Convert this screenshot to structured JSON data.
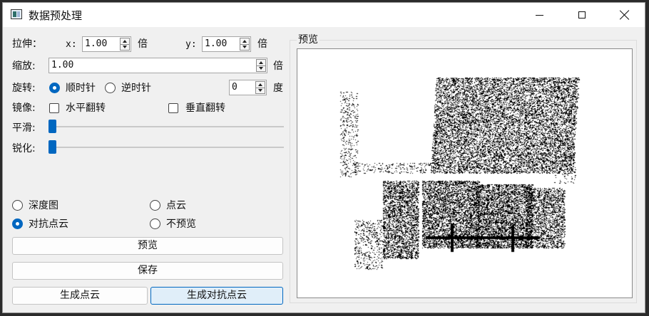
{
  "window": {
    "title": "数据预处理"
  },
  "stretch": {
    "label": "拉伸：",
    "x_label": "x:",
    "x_value": "1.00",
    "x_unit": "倍",
    "y_label": "y:",
    "y_value": "1.00",
    "y_unit": "倍"
  },
  "scale": {
    "label": "缩放:",
    "value": "1.00",
    "unit": "倍"
  },
  "rotate": {
    "label": "旋转:",
    "cw": "顺时针",
    "ccw": "逆时针",
    "degrees_value": "0",
    "unit": "度",
    "selected": "cw"
  },
  "mirror": {
    "label": "镜像:",
    "horizontal": "水平翻转",
    "vertical": "垂直翻转",
    "horizontal_checked": false,
    "vertical_checked": false
  },
  "smooth": {
    "label": "平滑:",
    "level": 0
  },
  "sharpen": {
    "label": "锐化:",
    "level": 0
  },
  "mode": {
    "depth": "深度图",
    "point_cloud": "点云",
    "adversarial": "对抗点云",
    "no_preview": "不预览",
    "selected": "adversarial"
  },
  "buttons": {
    "preview": "预览",
    "save": "保存",
    "generate": "生成点云",
    "generate_adv": "生成对抗点云"
  },
  "preview_group": {
    "title": "预览"
  },
  "colors": {
    "accent": "#0067c0",
    "window_bg": "#f0f0f0"
  }
}
